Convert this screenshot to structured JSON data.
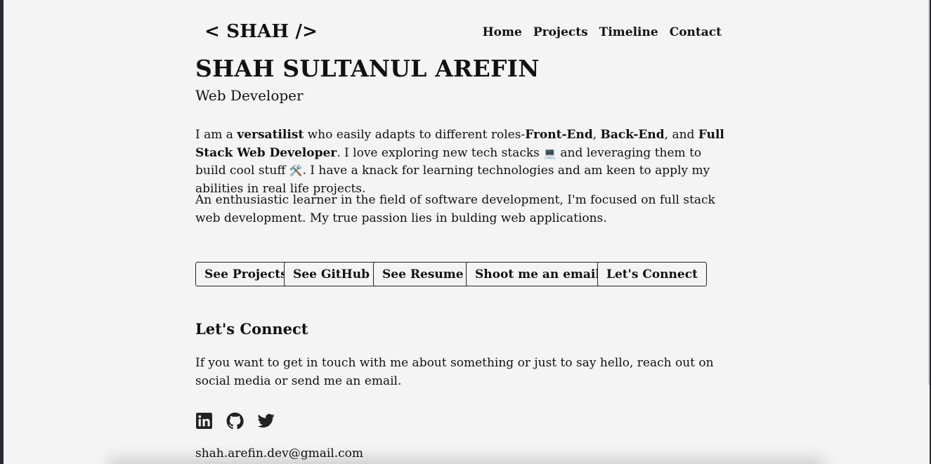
{
  "header": {
    "logo": "< SHAH />",
    "nav": [
      "Home",
      "Projects",
      "Timeline",
      "Contact"
    ]
  },
  "hero": {
    "name": "SHAH SULTANUL AREFIN",
    "role": "Web Developer"
  },
  "intro": {
    "p1_a": "I am a ",
    "p1_versatilist": "versatilist",
    "p1_b": " who easily adapts to different roles-",
    "p1_frontend": "Front-End",
    "p1_c": ", ",
    "p1_backend": "Back-End",
    "p1_d": ", and ",
    "p1_fullstack": "Full Stack Web Developer",
    "p1_e": ". I love exploring new tech stacks ",
    "p1_emoji_laptop": "💻",
    "p1_f": " and leveraging them to build cool stuff ",
    "p1_emoji_tools": "🛠️",
    "p1_g": ". I have a knack for learning technologies and am keen to apply my abilities in real life projects.",
    "p2": "An enthusiastic learner in the field of software development, I'm focused on full stack web development. My true passion lies in bulding web applications."
  },
  "buttons": [
    "See Projects",
    "See GitHub",
    "See Resume",
    "Shoot me an email",
    "Let's Connect"
  ],
  "connect": {
    "heading": "Let's Connect",
    "text": "If you want to get in touch with me about something or just to say hello, reach out on social media or send me an email.",
    "socials": [
      "linkedin-icon",
      "github-icon",
      "twitter-icon"
    ],
    "email": "shah.arefin.dev@gmail.com"
  },
  "colors": {
    "background": "#f4f4f4",
    "text": "#111111",
    "window_frame": "#2c2b33"
  }
}
